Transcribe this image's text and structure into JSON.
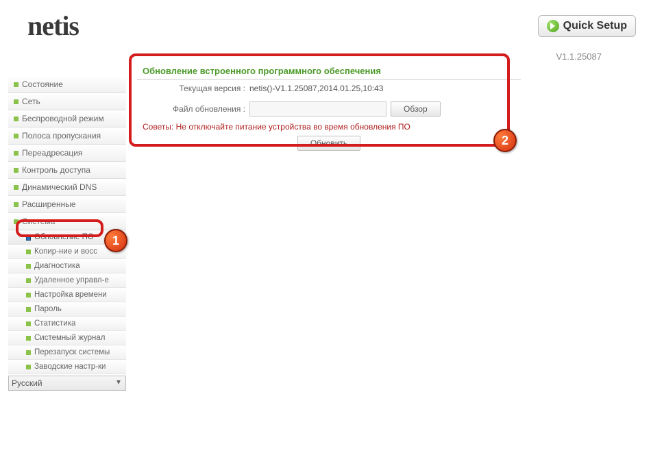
{
  "header": {
    "logo": "netis",
    "quick_setup": "Quick Setup",
    "version": "V1.1.25087"
  },
  "sidebar": {
    "items": [
      {
        "label": "Состояние"
      },
      {
        "label": "Сеть"
      },
      {
        "label": "Беспроводной режим"
      },
      {
        "label": "Полоса пропускания"
      },
      {
        "label": "Переадресация"
      },
      {
        "label": "Контроль доступа"
      },
      {
        "label": "Динамический DNS"
      },
      {
        "label": "Расширенные"
      },
      {
        "label": "Система"
      }
    ],
    "sub_items": [
      {
        "label": "Обновление ПО",
        "active": true
      },
      {
        "label": "Копир-ние и восс"
      },
      {
        "label": "Диагностика"
      },
      {
        "label": "Удаленное управл-е"
      },
      {
        "label": "Настройка времени"
      },
      {
        "label": "Пароль"
      },
      {
        "label": "Статистика"
      },
      {
        "label": "Системный журнал"
      },
      {
        "label": "Перезапуск системы"
      },
      {
        "label": "Заводские настр-ки"
      }
    ],
    "language": "Русский"
  },
  "main": {
    "title": "Обновление встроенного программного обеспечения",
    "current_version_label": "Текущая версия :",
    "current_version_value": "netis()-V1.1.25087,2014.01.25,10:43",
    "file_label": "Файл обновления :",
    "file_value": "",
    "browse": "Обзор",
    "hint": "Советы: Не отключайте питание устройства во время обновления ПО",
    "update": "Обновить"
  },
  "annotations": {
    "marker1": "1",
    "marker2": "2"
  }
}
